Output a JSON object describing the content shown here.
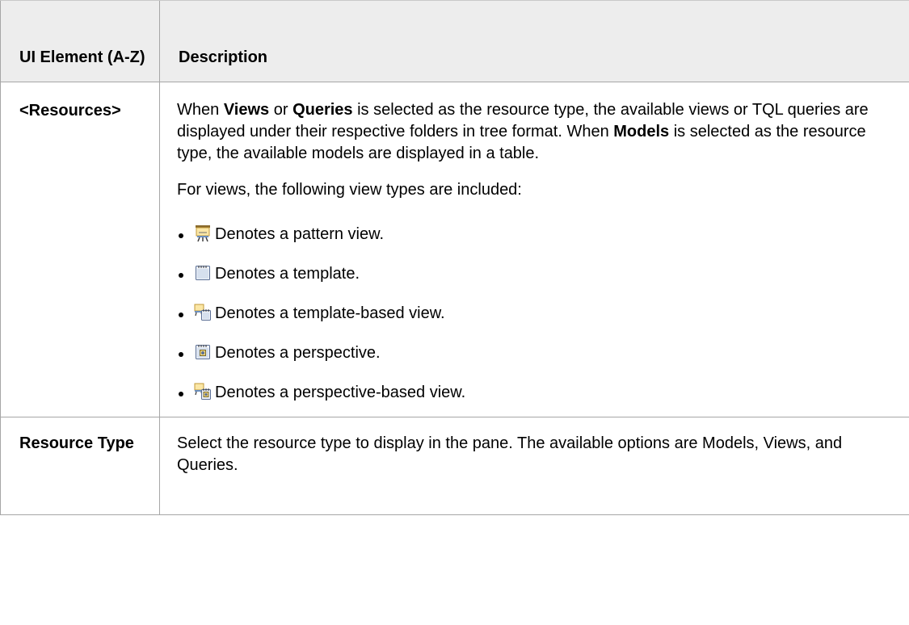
{
  "header": {
    "col1": "UI Element (A-Z)",
    "col2": "Description"
  },
  "rows": [
    {
      "term": "<Resources>",
      "para1_parts": [
        "When ",
        "Views",
        " or ",
        "Queries",
        " is selected as the resource type, the available views or TQL queries are displayed under their respective folders in tree format. When ",
        "Models",
        " is selected as the resource type, the available models are displayed in a table."
      ],
      "para2": "For views, the following view types are included:",
      "bullets": [
        {
          "icon": "pattern-view-icon",
          "text": "Denotes a pattern view."
        },
        {
          "icon": "template-icon",
          "text": "Denotes a template."
        },
        {
          "icon": "template-based-view-icon",
          "text": "Denotes a template-based view."
        },
        {
          "icon": "perspective-icon",
          "text": "Denotes a perspective."
        },
        {
          "icon": "perspective-based-view-icon",
          "text": "Denotes a perspective-based view."
        }
      ]
    },
    {
      "term": "Resource Type",
      "description": "Select the resource type to display in the pane. The available options are Models, Views, and Queries."
    }
  ],
  "colors": {
    "header_bg": "#ededed",
    "border": "#a6a6a6"
  }
}
